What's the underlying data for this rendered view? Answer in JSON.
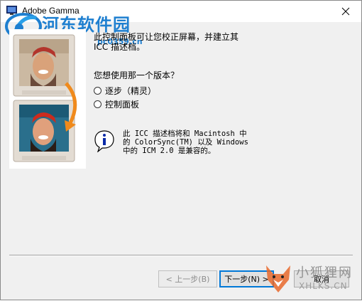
{
  "window": {
    "title": "Adobe Gamma"
  },
  "watermark_top": {
    "text": "河东软件园",
    "url": "pc0359.cn"
  },
  "intro": {
    "line1": "此控制面板可让您校正屏幕，并建立其",
    "line2": "ICC 描述档。"
  },
  "question": "您想使用那一个版本？",
  "options": [
    {
      "label": "逐步（精灵）",
      "selected": false
    },
    {
      "label": "控制面板",
      "selected": false
    }
  ],
  "info": {
    "line1": "此 ICC 描述档将和 Macintosh 中",
    "line2": "的 ColorSync(TM) 以及 Windows",
    "line3": "中的 ICM 2.0 是兼容的。"
  },
  "buttons": {
    "back": "< 上一步(B)",
    "next": "下一步(N) >",
    "cancel": "取消"
  },
  "watermark_br": {
    "text": "小狐狸网",
    "url": "XHLKS.CN"
  },
  "colors": {
    "accent": "#0078d7",
    "watermark_blue": "#1e7fd0"
  }
}
